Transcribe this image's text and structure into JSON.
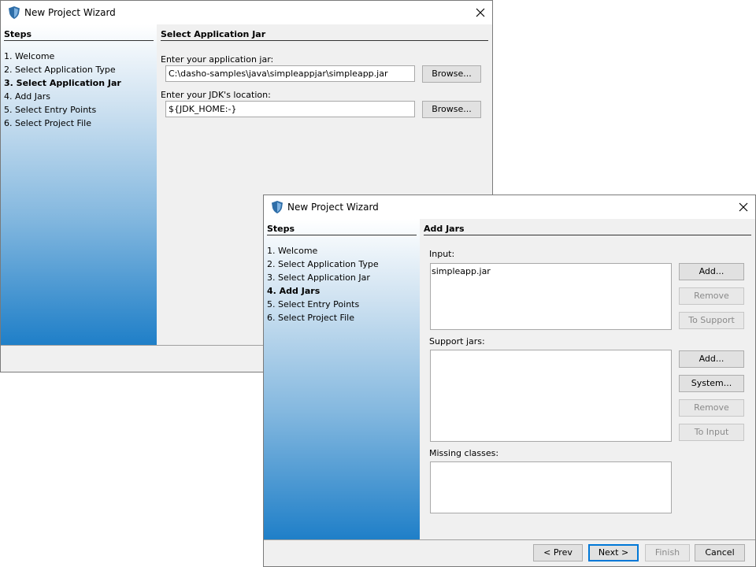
{
  "back_window": {
    "title": "New Project Wizard",
    "steps_heading": "Steps",
    "steps": [
      "1. Welcome",
      "2. Select Application Type",
      "3. Select Application Jar",
      "4. Add Jars",
      "5. Select Entry Points",
      "6. Select Project File"
    ],
    "active_step": 2,
    "section_heading": "Select Application Jar",
    "app_jar_label": "Enter your application jar:",
    "app_jar_value": "C:\\dasho-samples\\java\\simpleappjar\\simpleapp.jar",
    "browse_label": "Browse...",
    "jdk_label": "Enter your JDK's location:",
    "jdk_value": "${JDK_HOME:-}",
    "browse2_label": "Browse..."
  },
  "front_window": {
    "title": "New Project Wizard",
    "steps_heading": "Steps",
    "steps": [
      "1. Welcome",
      "2. Select Application Type",
      "3. Select Application Jar",
      "4. Add Jars",
      "5. Select Entry Points",
      "6. Select Project File"
    ],
    "active_step": 3,
    "section_heading": "Add Jars",
    "input_label": "Input:",
    "input_items": [
      "simpleapp.jar"
    ],
    "input_buttons": {
      "add": "Add...",
      "remove": "Remove",
      "to_support": "To Support"
    },
    "support_label": "Support jars:",
    "support_buttons": {
      "add": "Add...",
      "system": "System...",
      "remove": "Remove",
      "to_input": "To Input"
    },
    "missing_label": "Missing classes:",
    "nav": {
      "prev": "< Prev",
      "next": "Next >",
      "finish": "Finish",
      "cancel": "Cancel"
    }
  },
  "colors": {
    "accent": "#0078d7",
    "gradient_bottom": "#1f7fc8",
    "shield": "#2f6ea8"
  }
}
